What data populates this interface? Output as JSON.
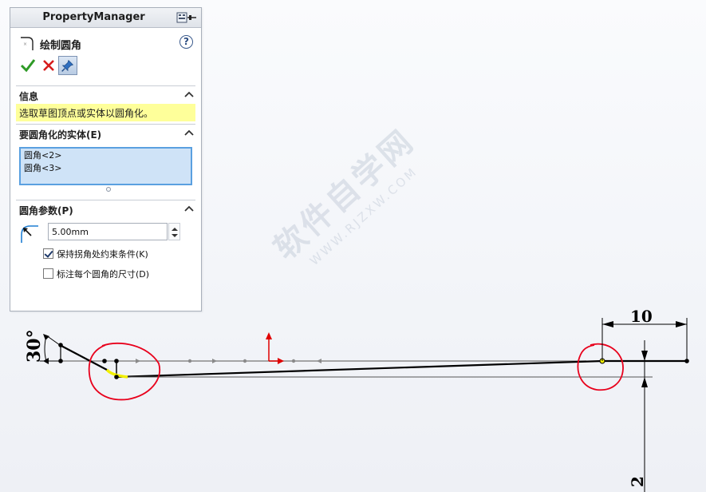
{
  "watermark": {
    "main": "软件自学网",
    "sub": "WWW.RJZXW.COM"
  },
  "property_manager": {
    "title": "PropertyManager",
    "feature_title": "绘制圆角",
    "help_label": "?",
    "sections": {
      "info": {
        "title": "信息",
        "message": "选取草图顶点或实体以圆角化。"
      },
      "entities": {
        "title": "要圆角化的实体(E)",
        "items": [
          "圆角<2>",
          "圆角<3>"
        ]
      },
      "params": {
        "title": "圆角参数(P)",
        "radius_value": "5.00mm",
        "keep_constraints": {
          "label": "保持拐角处约束条件(K)",
          "checked": true
        },
        "dimension_each": {
          "label": "标注每个圆角的尺寸(D)",
          "checked": false
        }
      }
    }
  },
  "drawing": {
    "angle_dimension": "30°",
    "horizontal_dimension": "10",
    "vertical_dimension": "2"
  },
  "colors": {
    "sketch_line": "#000000",
    "construction_line": "#8a8a8a",
    "highlight_circle": "#e8001c",
    "fillet_highlight": "#f2f000",
    "origin_axis": "#e00000",
    "selection_blue": "#5aa0e0",
    "info_yellow": "#feff9a"
  }
}
